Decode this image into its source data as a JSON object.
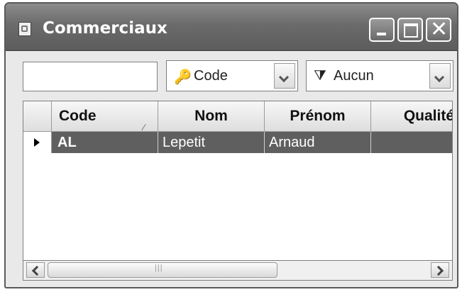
{
  "window": {
    "title": "Commerciaux"
  },
  "toolbar": {
    "search_value": "",
    "sort_field": {
      "icon": "key-icon",
      "label": "Code"
    },
    "filter": {
      "icon": "funnel-icon",
      "label": "Aucun"
    }
  },
  "table": {
    "columns": [
      "Code",
      "Nom",
      "Prénom",
      "Qualité"
    ],
    "rows": [
      {
        "code": "AL",
        "nom": "Lepetit",
        "prenom": "Arnaud",
        "qualite": ""
      }
    ]
  }
}
